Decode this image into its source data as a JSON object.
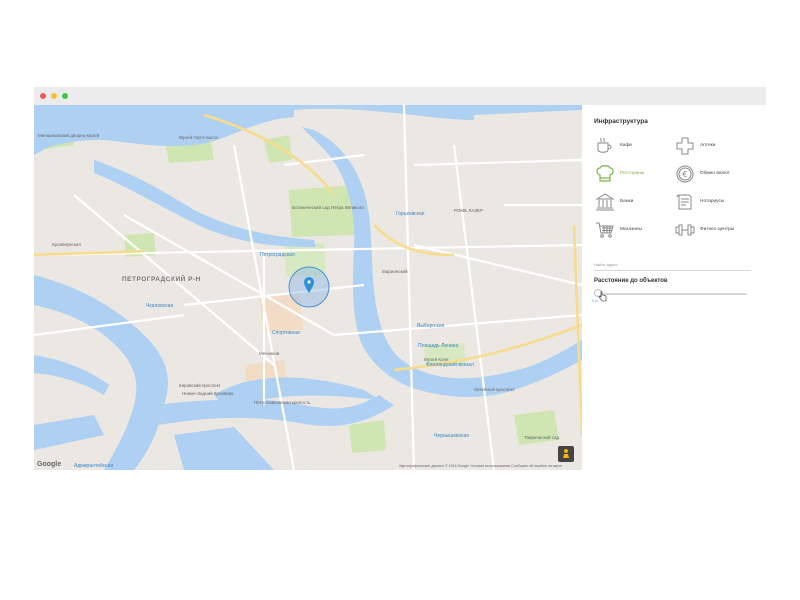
{
  "window": {
    "controls": [
      {
        "name": "close",
        "color": "#ee5d55"
      },
      {
        "name": "minimize",
        "color": "#f6be2f"
      },
      {
        "name": "maximize",
        "color": "#3fc74a"
      }
    ]
  },
  "map": {
    "district_label": "ПЕТРОГРАДСКИЙ Р-Н",
    "place_labels": [
      {
        "text": "Меншиковский дворец-музей",
        "kind": "normal"
      },
      {
        "text": "Музей Гаупт-вахта",
        "kind": "normal"
      },
      {
        "text": "Кронверкская",
        "kind": "normal"
      },
      {
        "text": "Ботанический сад Петра Великого",
        "kind": "normal"
      },
      {
        "text": "Горьковская",
        "kind": "metro"
      },
      {
        "text": "Петроградская",
        "kind": "metro"
      },
      {
        "text": "Чкаловская",
        "kind": "metro"
      },
      {
        "text": "Спортивная",
        "kind": "metro"
      },
      {
        "text": "Мариинский",
        "kind": "normal"
      },
      {
        "text": "Выборгская",
        "kind": "metro"
      },
      {
        "text": "РОМБ ЛАЗЕР",
        "kind": "normal"
      },
      {
        "text": "Мечников",
        "kind": "normal"
      },
      {
        "text": "Площадь Ленина",
        "kind": "metro"
      },
      {
        "text": "Кировский проспект",
        "kind": "normal"
      },
      {
        "text": "Музей Коне",
        "kind": "normal"
      },
      {
        "text": "Литейный проспект",
        "kind": "normal"
      },
      {
        "text": "Финляндский вокзал",
        "kind": "metro"
      },
      {
        "text": "Нижне-Задний Кронверк",
        "kind": "normal"
      },
      {
        "text": "Петропавловская крепость",
        "kind": "normal"
      },
      {
        "text": "Чернышевская",
        "kind": "metro"
      },
      {
        "text": "Таврический сад",
        "kind": "normal"
      },
      {
        "text": "Адмиралтейская",
        "kind": "metro"
      }
    ],
    "google_logo": "Google",
    "attribution": "Картографические данные © 2016 Google   Условия использования   Сообщить об ошибке на карте",
    "pin_color": "#2d8fd5",
    "radius_color": "#4a90d9"
  },
  "panel": {
    "infra_title": "Инфраструктура",
    "infra_items": [
      {
        "label": "Кафе",
        "icon": "coffee-cup-icon",
        "active": false
      },
      {
        "label": "Аптеки",
        "icon": "pharmacy-cross-icon",
        "active": false
      },
      {
        "label": "Рестораны",
        "icon": "chef-hat-icon",
        "active": true
      },
      {
        "label": "Обмен валют",
        "icon": "euro-coin-icon",
        "active": false
      },
      {
        "label": "Банки",
        "icon": "bank-icon",
        "active": false
      },
      {
        "label": "Нотариусы",
        "icon": "notary-document-icon",
        "active": false
      },
      {
        "label": "Магазины",
        "icon": "shopping-cart-icon",
        "active": false
      },
      {
        "label": "Фитнес-центры",
        "icon": "dumbbell-icon",
        "active": false
      }
    ],
    "search_placeholder": "Найти адрес",
    "distance_title": "Расстояние до объектов",
    "distance_value": "0 м",
    "active_color": "#7cb34a",
    "icon_color": "#888888"
  }
}
